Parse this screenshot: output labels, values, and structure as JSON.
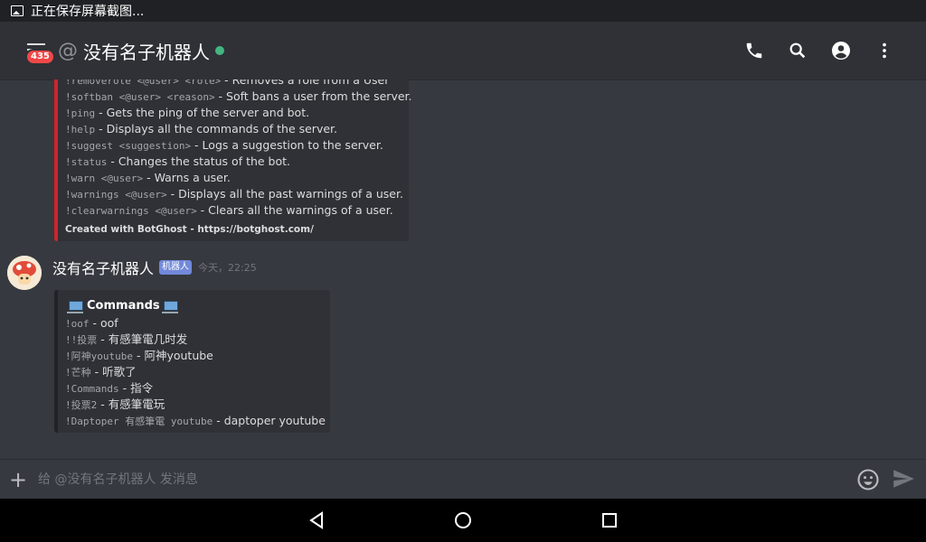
{
  "statusbar": {
    "notification": "正在保存屏幕截图..."
  },
  "header": {
    "badge_count": "435",
    "at_symbol": "@",
    "channel_name": "没有名子机器人",
    "online_color": "#43b581",
    "actions": [
      "phone-icon",
      "search-icon",
      "account-icon",
      "more-vert-icon"
    ]
  },
  "embed1": {
    "accent_color": "#d0232b",
    "lines": [
      {
        "code": "!removerole <@user> <role>",
        "desc": "Removes a role from a User"
      },
      {
        "code": "!softban <@user> <reason>",
        "desc": "Soft bans a user from the server."
      },
      {
        "code": "!ping",
        "desc": "Gets the ping of the server and bot."
      },
      {
        "code": "!help",
        "desc": "Displays all the commands of the server."
      },
      {
        "code": "!suggest <suggestion>",
        "desc": "Logs a suggestion to the server."
      },
      {
        "code": "!status",
        "desc": "Changes the status of the bot."
      },
      {
        "code": "!warn <@user>",
        "desc": "Warns a user."
      },
      {
        "code": "!warnings <@user>",
        "desc": "Displays all the past warnings of a user."
      },
      {
        "code": "!clearwarnings <@user>",
        "desc": "Clears all the warnings of a user."
      }
    ],
    "footer": "Created with BotGhost - https://botghost.com/"
  },
  "message": {
    "username": "没有名子机器人",
    "bot_tag": "机器人",
    "timestamp": "今天，22:25"
  },
  "embed2": {
    "title": "Commands",
    "lines": [
      {
        "code": "!oof",
        "desc": "oof"
      },
      {
        "code": "!!投票",
        "desc": "有感筆電几时发"
      },
      {
        "code": "!阿神youtube",
        "desc": "阿神youtube"
      },
      {
        "code": "!芒种",
        "desc": "听歌了"
      },
      {
        "code": "!Commands",
        "desc": "指令"
      },
      {
        "code": "!投票2",
        "desc": "有感筆電玩"
      },
      {
        "code": "!Daptoper 有感筆電 youtube",
        "desc": "daptoper youtube"
      }
    ]
  },
  "composer": {
    "placeholder": "给 @没有名子机器人 发消息",
    "plus": "+"
  },
  "navbar": {
    "buttons": [
      "back-icon",
      "home-icon",
      "recents-icon"
    ]
  },
  "sep": " - "
}
